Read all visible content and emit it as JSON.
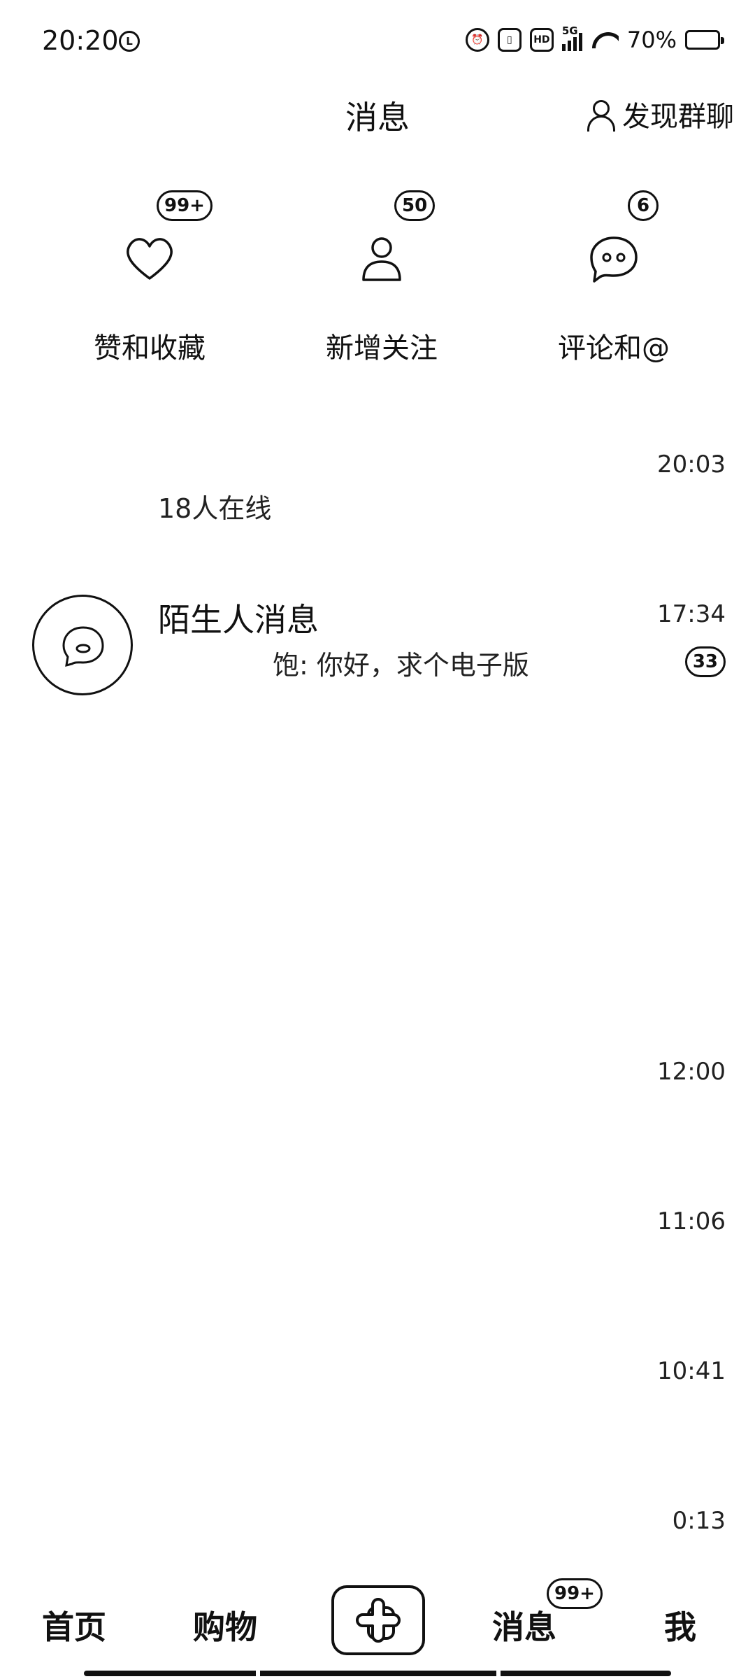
{
  "status_bar": {
    "time": "20:20",
    "network": "5G",
    "hd": "HD",
    "battery": "70%"
  },
  "header": {
    "title": "消息",
    "discover_label": "发现群聊"
  },
  "quick_entries": [
    {
      "label": "赞和收藏",
      "badge": "99+",
      "icon": "heart-icon"
    },
    {
      "label": "新增关注",
      "badge": "50",
      "icon": "person-icon"
    },
    {
      "label": "评论和@",
      "badge": "6",
      "icon": "chat-bubble-icon"
    }
  ],
  "conversations": [
    {
      "title": "",
      "subtitle": "18人在线",
      "time": "20:03"
    },
    {
      "title": "陌生人消息",
      "subtitle": "饱: 你好，求个电子版",
      "time": "17:34",
      "badge": "33"
    },
    {
      "title": "",
      "subtitle": "",
      "time": "12:00"
    },
    {
      "title": "",
      "subtitle": "",
      "time": "11:06"
    },
    {
      "title": "",
      "subtitle": "",
      "time": "10:41"
    },
    {
      "title": "",
      "subtitle": "",
      "time": "0:13"
    }
  ],
  "bottom_nav": {
    "home": "首页",
    "shop": "购物",
    "messages": "消息",
    "messages_badge": "99+",
    "me": "我"
  }
}
